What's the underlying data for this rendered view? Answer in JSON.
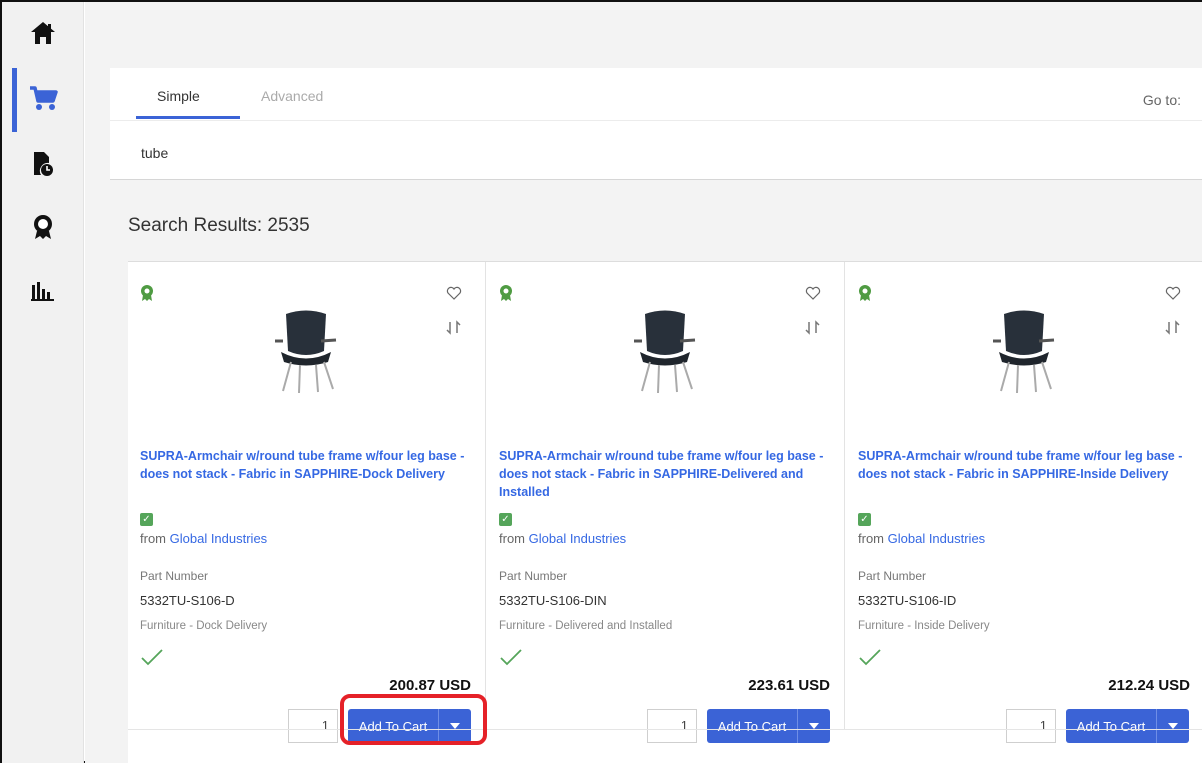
{
  "sidebar": {
    "items": [
      {
        "icon": "home-icon"
      },
      {
        "icon": "cart-icon",
        "active": true
      },
      {
        "icon": "order-history-icon"
      },
      {
        "icon": "award-icon"
      },
      {
        "icon": "analytics-icon"
      }
    ]
  },
  "search": {
    "tabs": {
      "simple": "Simple",
      "advanced": "Advanced"
    },
    "goto_label": "Go to:",
    "query": "tube"
  },
  "results": {
    "title": "Search Results: 2535",
    "cards": [
      {
        "title": "SUPRA-Armchair w/round tube frame w/four leg base - does not stack - Fabric in SAPPHIRE-Dock Delivery",
        "from": "from",
        "supplier": "Global Industries",
        "part_label": "Part Number",
        "part_number": "5332TU-S106-D",
        "category": "Furniture - Dock Delivery",
        "price": "200.87",
        "currency": "USD",
        "qty": "1",
        "button": "Add To Cart"
      },
      {
        "title": "SUPRA-Armchair w/round tube frame w/four leg base - does not stack - Fabric in SAPPHIRE-Delivered and Installed",
        "from": "from",
        "supplier": "Global Industries",
        "part_label": "Part Number",
        "part_number": "5332TU-S106-DIN",
        "category": "Furniture - Delivered and Installed",
        "price": "223.61",
        "currency": "USD",
        "qty": "1",
        "button": "Add To Cart"
      },
      {
        "title": "SUPRA-Armchair w/round tube frame w/four leg base - does not stack - Fabric in SAPPHIRE-Inside Delivery",
        "from": "from",
        "supplier": "Global Industries",
        "part_label": "Part Number",
        "part_number": "5332TU-S106-ID",
        "category": "Furniture - Inside Delivery",
        "price": "212.24",
        "currency": "USD",
        "qty": "1",
        "button": "Add To Cart"
      }
    ]
  },
  "colors": {
    "accent": "#3b63d6",
    "link": "#3568e3",
    "success": "#55a55a",
    "highlight": "#e52128"
  }
}
